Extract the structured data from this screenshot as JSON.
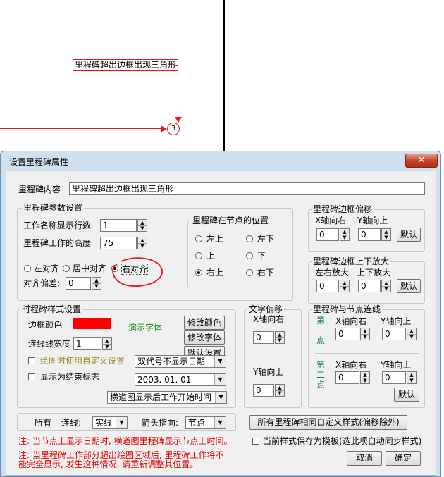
{
  "canvas": {
    "milestone_label": "里程碑超出边框出现三角形",
    "node_number": "3"
  },
  "dialog": {
    "title": "设置里程碑属性",
    "close_glyph": "✕",
    "milestone_content_label": "里程碑内容",
    "milestone_content_value": "里程碑超出边框出现三角形",
    "params": {
      "title": "里程碑参数设置",
      "rows_label": "工作名称显示行数",
      "rows_value": "1",
      "height_label": "里程碑工作的高度",
      "height_value": "75",
      "align_left": "左对齐",
      "align_center": "居中对齐",
      "align_right": "右对齐",
      "align_offset_label": "对齐偏差:",
      "align_offset_value": "0"
    },
    "position": {
      "title": "里程碑在节点的位置",
      "top_left": "左上",
      "bottom_left": "左下",
      "top": "上",
      "bottom": "下",
      "top_right": "右上",
      "bottom_right": "右下"
    },
    "border_offset": {
      "title": "里程碑边框偏移",
      "x_label": "X轴向右",
      "y_label": "Y轴向上",
      "x_value": "0",
      "y_value": "0",
      "default_btn": "默认"
    },
    "border_zoom": {
      "title": "里程碑边框上下放大",
      "lr_label": "左右放大",
      "ud_label": "上下放大",
      "lr_value": "0",
      "ud_value": "0",
      "default_btn": "默认"
    },
    "style": {
      "title": "时程碑样式设置",
      "border_color_label": "边框颜色",
      "border_color": "#ff0000",
      "demo_font": "演示字体",
      "change_color_btn": "修改颜色",
      "change_font_btn": "修改字体",
      "default_btn": "默认设置",
      "line_width_label": "连线线宽度",
      "line_width_value": "1",
      "custom_setting_label": "绘图时使用自定义设置",
      "date_format_select": "双代号不显示日期",
      "end_marker_label": "显示为结束标志",
      "date_value": "2003. 01. 01",
      "time_display_select": "横道图显示后工作开始时间"
    },
    "text_offset": {
      "title": "文字偏移",
      "x_label": "X轴向右",
      "x_value": "0",
      "y_label": "Y轴向上",
      "y_value": "0"
    },
    "node_link": {
      "title": "里程碑与节点连线",
      "first_point": "第一点",
      "second_point": "第二点",
      "x_label": "X轴向右",
      "y_label": "Y轴向上",
      "p1_x": "0",
      "p1_y": "0",
      "p2_x": "0",
      "p2_y": "0",
      "default_btn": "默认"
    },
    "bottom_bar": {
      "all_label": "所有",
      "line_label": "连线:",
      "line_select": "实线",
      "arrow_label": "箭头指向:",
      "arrow_select": "节点"
    },
    "apply_all_btn": "所有里程碑相同自定义样式(偏移除外)",
    "save_template_label": "当前样式保存为模板(选此项自动同步样式)",
    "note1": "注: 当节点上显示日期时, 横道图里程碑显示节点上时间。",
    "note2_line1": "注: 当里程碑工作部分超出绘图区域后, 里程碑工作将不",
    "note2_line2": "能完全显示, 发生这种情况, 请重新调整其位置。",
    "cancel_btn": "取消",
    "ok_btn": "确定"
  }
}
